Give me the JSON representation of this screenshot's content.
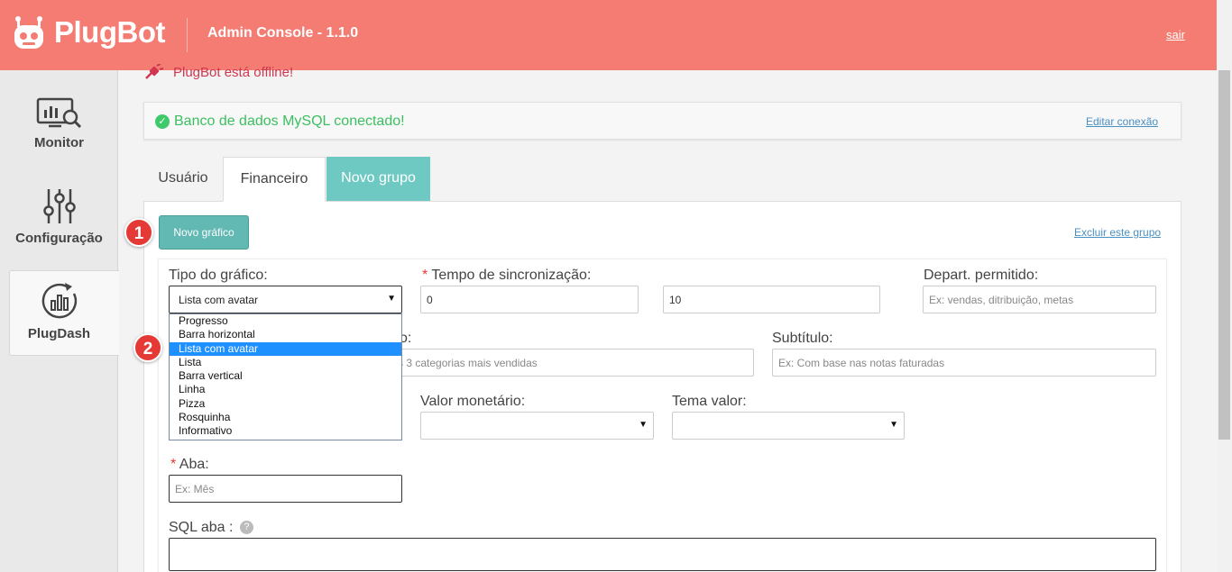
{
  "header": {
    "brand": "PlugBot",
    "console_title": "Admin Console - 1.1.0",
    "logout_label": "sair",
    "color": "#f47c73"
  },
  "sidebar": {
    "items": [
      {
        "label": "Monitor",
        "icon": "monitor-chart-icon"
      },
      {
        "label": "Configuração",
        "icon": "sliders-icon"
      },
      {
        "label": "PlugDash",
        "icon": "dashboard-chart-icon",
        "active": true
      }
    ]
  },
  "status": {
    "offline_text": "PlugBot está offline!",
    "db_text": "Banco de dados MySQL conectado!",
    "db_edit_label": "Editar conexão"
  },
  "tabs": [
    {
      "label": "Usuário"
    },
    {
      "label": "Financeiro",
      "active": true
    },
    {
      "label": "Novo grupo"
    }
  ],
  "panel": {
    "new_chart_label": "Novo gráfico",
    "delete_group_label": "Excluir este grupo"
  },
  "badges": [
    "1",
    "2"
  ],
  "form": {
    "tipo": {
      "label": "Tipo do gráfico:",
      "value": "Lista com avatar"
    },
    "tempo": {
      "label": "Tempo de sincronização:",
      "value1": "0",
      "value2": "10"
    },
    "depart": {
      "label": "Depart. permitido:",
      "placeholder": "Ex: vendas, ditribuição, metas"
    },
    "titulo": {
      "label_fragment": "o:",
      "placeholder_fragment": "s 3 categorias mais vendidas"
    },
    "subtitulo": {
      "label": "Subtítulo:",
      "placeholder": "Ex: Com base nas notas faturadas"
    },
    "valor": {
      "label": "Valor monetário:",
      "value": ""
    },
    "tema": {
      "label": "Tema valor:",
      "value": ""
    },
    "aba": {
      "label": "Aba:",
      "placeholder": "Ex: Mês"
    },
    "sql_aba": {
      "label": "SQL aba :",
      "help": "?"
    },
    "required_mark": "*"
  },
  "dropdown": {
    "options": [
      "Progresso",
      "Barra horizontal",
      "Lista com avatar",
      "Lista",
      "Barra vertical",
      "Linha",
      "Pizza",
      "Rosquinha",
      "Informativo"
    ],
    "selected_index": 2
  }
}
